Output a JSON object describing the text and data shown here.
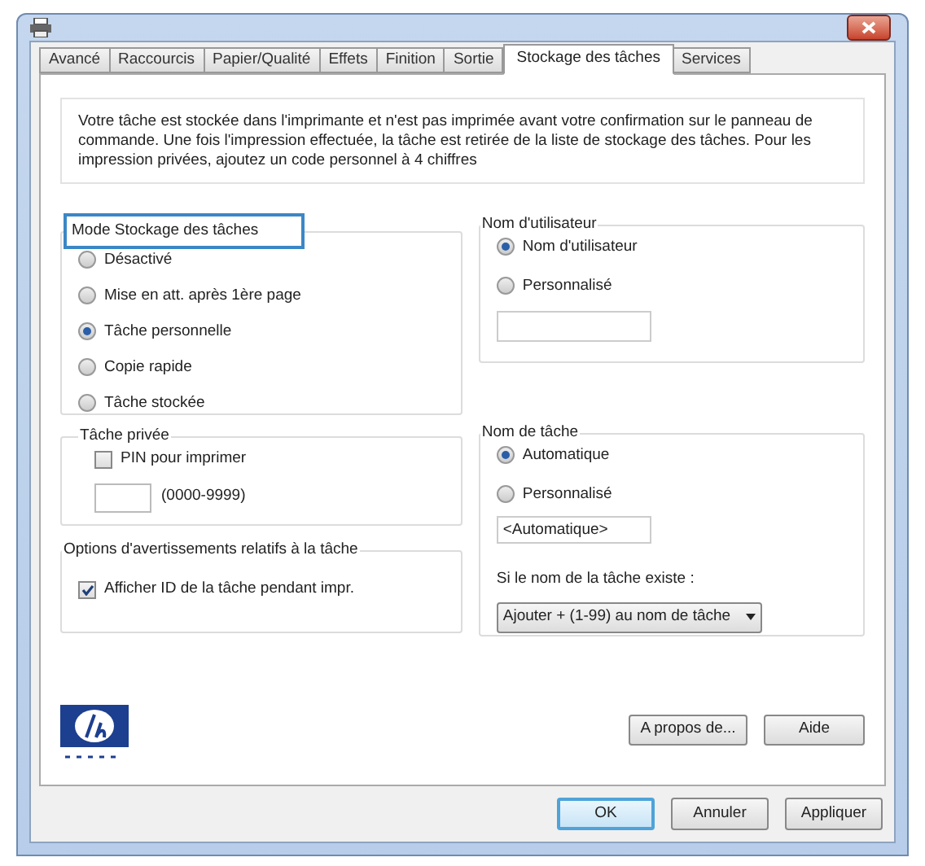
{
  "tabs": [
    {
      "label": "Avancé",
      "selected": false
    },
    {
      "label": "Raccourcis",
      "selected": false
    },
    {
      "label": "Papier/Qualité",
      "selected": false
    },
    {
      "label": "Effets",
      "selected": false
    },
    {
      "label": "Finition",
      "selected": false
    },
    {
      "label": "Sortie",
      "selected": false
    },
    {
      "label": "Stockage des tâches",
      "selected": true
    },
    {
      "label": "Services",
      "selected": false
    }
  ],
  "description": "Votre tâche est stockée dans l'imprimante et n'est pas imprimée avant votre confirmation sur le panneau de commande.  Une fois l'impression effectuée, la tâche est retirée de la liste de stockage des tâches.   Pour les impression privées, ajoutez un code personnel à 4 chiffres",
  "storage_mode": {
    "title": "Mode Stockage des tâches",
    "highlighted": true,
    "options": [
      {
        "label": "Désactivé",
        "selected": false
      },
      {
        "label": "Mise en att. après 1ère page",
        "selected": false
      },
      {
        "label": "Tâche personnelle",
        "selected": true
      },
      {
        "label": "Copie rapide",
        "selected": false
      },
      {
        "label": "Tâche stockée",
        "selected": false
      }
    ]
  },
  "private_job": {
    "title": "Tâche privée",
    "pin": {
      "label": "PIN pour imprimer",
      "checked": false
    },
    "range": "(0000-9999)"
  },
  "notification_options": {
    "title": "Options d'avertissements relatifs à la tâche",
    "show_id": {
      "label": "Afficher ID de la tâche pendant impr.",
      "checked": true
    }
  },
  "user_name": {
    "title": "Nom d'utilisateur",
    "options": [
      {
        "label": "Nom d'utilisateur",
        "selected": true
      },
      {
        "label": "Personnalisé",
        "selected": false
      }
    ]
  },
  "job_name": {
    "title": "Nom de tâche",
    "options": [
      {
        "label": "Automatique",
        "selected": true
      },
      {
        "label": "Personnalisé",
        "selected": false
      }
    ],
    "field_value": "<Automatique>",
    "exists_label": "Si le nom de la tâche existe :",
    "exists_choice": "Ajouter + (1-99) au nom de tâche"
  },
  "side_buttons": [
    "A propos de...",
    "Aide"
  ],
  "dialog_buttons": [
    {
      "label": "OK",
      "default": true
    },
    {
      "label": "Annuler",
      "default": false
    },
    {
      "label": "Appliquer",
      "default": false
    }
  ]
}
